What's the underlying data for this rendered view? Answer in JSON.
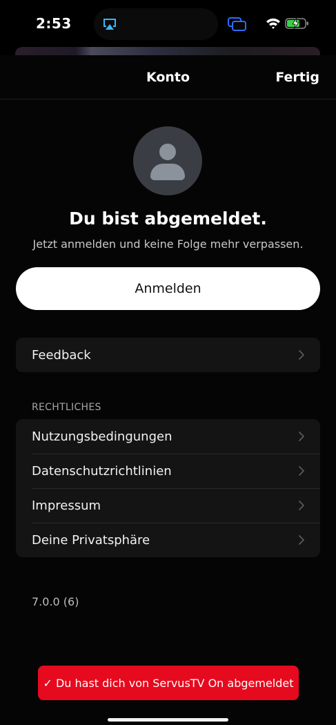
{
  "status_bar": {
    "time": "2:53"
  },
  "nav": {
    "title": "Konto",
    "done_label": "Fertig"
  },
  "profile": {
    "headline": "Du bist abgemeldet.",
    "subline": "Jetzt anmelden und keine Folge mehr verpassen.",
    "login_label": "Anmelden"
  },
  "feedback": {
    "label": "Feedback"
  },
  "legal": {
    "header": "RECHTLICHES",
    "items": [
      {
        "label": "Nutzungsbedingungen"
      },
      {
        "label": "Datenschutzrichtlinien"
      },
      {
        "label": "Impressum"
      },
      {
        "label": "Deine Privatsphäre"
      }
    ]
  },
  "version": "7.0.0 (6)",
  "toast": {
    "message": "✓ Du hast dich von ServusTV On abgemeldet"
  },
  "colors": {
    "toast": "#e60a1e",
    "background": "#000000",
    "group": "#141414",
    "battery_charging": "#3cd24a"
  }
}
